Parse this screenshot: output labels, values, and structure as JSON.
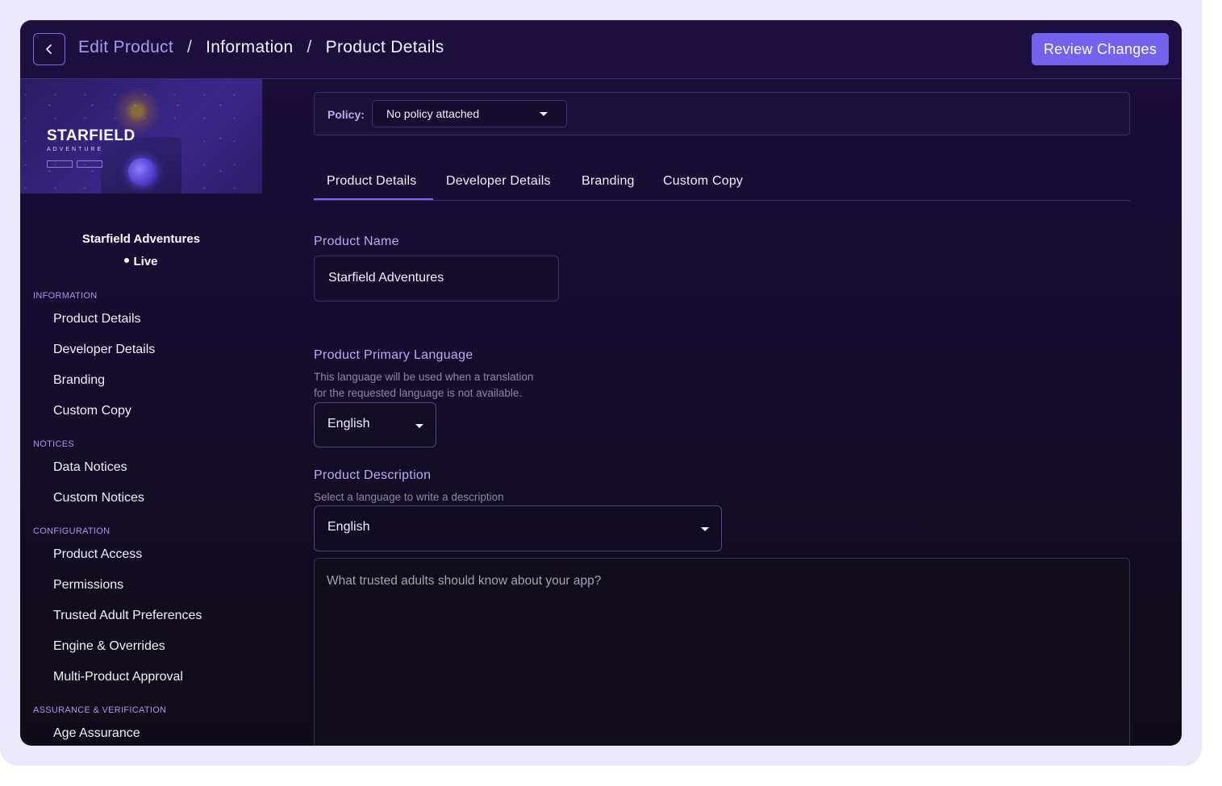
{
  "header": {
    "breadcrumbs": [
      "Edit Product",
      "Information",
      "Product Details"
    ],
    "separator": "/",
    "review_button": "Review Changes"
  },
  "sidebar": {
    "banner": {
      "title": "STARFIELD",
      "subtitle": "ADVENTURE"
    },
    "product_name": "Starfield Adventures",
    "status": "Live",
    "sections": [
      {
        "title": "INFORMATION",
        "items": [
          "Product Details",
          "Developer Details",
          "Branding",
          "Custom Copy"
        ]
      },
      {
        "title": "NOTICES",
        "items": [
          "Data Notices",
          "Custom Notices"
        ]
      },
      {
        "title": "CONFIGURATION",
        "items": [
          "Product Access",
          "Permissions",
          "Trusted Adult Preferences",
          "Engine & Overrides",
          "Multi-Product Approval"
        ]
      },
      {
        "title": "ASSURANCE & VERIFICATION",
        "items": [
          "Age Assurance"
        ]
      }
    ]
  },
  "policy": {
    "label": "Policy:",
    "value": "No policy attached"
  },
  "tabs": [
    "Product Details",
    "Developer Details",
    "Branding",
    "Custom Copy"
  ],
  "active_tab": "Product Details",
  "form": {
    "product_name": {
      "label": "Product Name",
      "value": "Starfield Adventures"
    },
    "primary_language": {
      "label": "Product Primary Language",
      "help_line1": "This language will be used when a translation",
      "help_line2": "for the requested language is not available.",
      "value": "English"
    },
    "description": {
      "label": "Product Description",
      "help": "Select a language to write a description",
      "language": "English",
      "placeholder": "What trusted adults should know about your app?"
    }
  },
  "colors": {
    "accent": "#7461ee",
    "link": "#a99af2",
    "background": "#1b0f3a",
    "frame": "#ebe8fb"
  }
}
